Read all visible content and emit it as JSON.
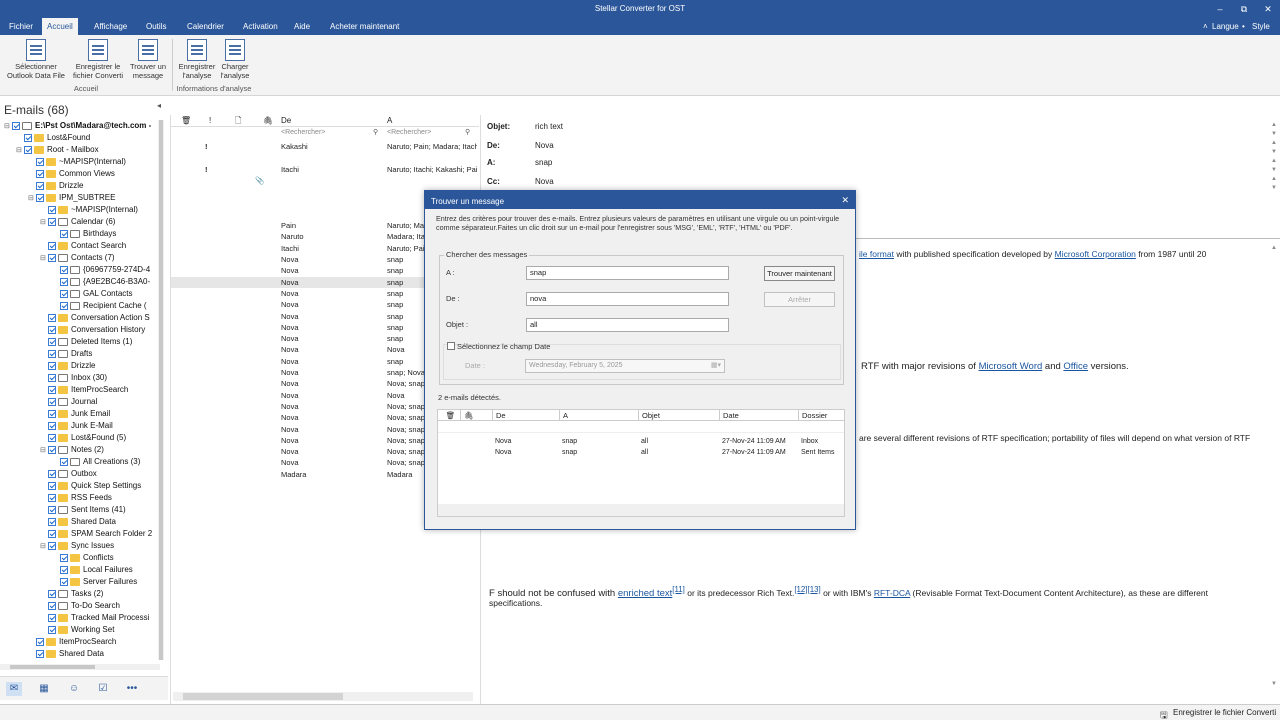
{
  "window": {
    "title": "Stellar Converter for OST",
    "min": "–",
    "max": "⧉",
    "close": "✕"
  },
  "menu": {
    "items": [
      "Fichier",
      "Accueil",
      "Affichage",
      "Outils",
      "Calendrier",
      "Activation",
      "Aide",
      "Acheter maintenant"
    ],
    "active": "Accueil",
    "langue": "Langue",
    "style": "Style"
  },
  "ribbon": {
    "buttons": [
      {
        "line1": "Sélectionner",
        "line2": "Outlook Data File"
      },
      {
        "line1": "Enregistrer le",
        "line2": "fichier Converti"
      },
      {
        "line1": "Trouver un",
        "line2": "message"
      },
      {
        "line1": "Enregistrer",
        "line2": "l'analyse"
      },
      {
        "line1": "Charger",
        "line2": "l'analyse"
      }
    ],
    "groups": [
      "Accueil",
      "Informations d'analyse"
    ]
  },
  "left": {
    "header": "E-mails (68)",
    "tree": [
      {
        "label": "E:\\Pst Ost\\Madara@tech.com -",
        "depth": 0,
        "exp": "⊟",
        "type": "root"
      },
      {
        "label": "Lost&Found",
        "depth": 1,
        "exp": "",
        "type": "folder"
      },
      {
        "label": "Root - Mailbox",
        "depth": 1,
        "exp": "⊟",
        "type": "folder"
      },
      {
        "label": "~MAPISP(Internal)",
        "depth": 2,
        "exp": "",
        "type": "folder"
      },
      {
        "label": "Common Views",
        "depth": 2,
        "exp": "",
        "type": "folder"
      },
      {
        "label": "Drizzle",
        "depth": 2,
        "exp": "",
        "type": "folder"
      },
      {
        "label": "IPM_SUBTREE",
        "depth": 2,
        "exp": "⊟",
        "type": "folder"
      },
      {
        "label": "~MAPISP(Internal)",
        "depth": 3,
        "exp": "",
        "type": "folder"
      },
      {
        "label": "Calendar (6)",
        "depth": 3,
        "exp": "⊟",
        "type": "special"
      },
      {
        "label": "Birthdays",
        "depth": 4,
        "exp": "",
        "type": "special"
      },
      {
        "label": "Contact Search",
        "depth": 3,
        "exp": "",
        "type": "folder"
      },
      {
        "label": "Contacts (7)",
        "depth": 3,
        "exp": "⊟",
        "type": "special"
      },
      {
        "label": "{06967759-274D-4",
        "depth": 4,
        "exp": "",
        "type": "special"
      },
      {
        "label": "{A9E2BC46-B3A0-",
        "depth": 4,
        "exp": "",
        "type": "special"
      },
      {
        "label": "GAL Contacts",
        "depth": 4,
        "exp": "",
        "type": "special"
      },
      {
        "label": "Recipient Cache (",
        "depth": 4,
        "exp": "",
        "type": "special"
      },
      {
        "label": "Conversation Action S",
        "depth": 3,
        "exp": "",
        "type": "folder"
      },
      {
        "label": "Conversation History",
        "depth": 3,
        "exp": "",
        "type": "folder"
      },
      {
        "label": "Deleted Items (1)",
        "depth": 3,
        "exp": "",
        "type": "special"
      },
      {
        "label": "Drafts",
        "depth": 3,
        "exp": "",
        "type": "special"
      },
      {
        "label": "Drizzle",
        "depth": 3,
        "exp": "",
        "type": "folder"
      },
      {
        "label": "Inbox (30)",
        "depth": 3,
        "exp": "",
        "type": "special"
      },
      {
        "label": "ItemProcSearch",
        "depth": 3,
        "exp": "",
        "type": "folder"
      },
      {
        "label": "Journal",
        "depth": 3,
        "exp": "",
        "type": "special"
      },
      {
        "label": "Junk Email",
        "depth": 3,
        "exp": "",
        "type": "folder"
      },
      {
        "label": "Junk E-Mail",
        "depth": 3,
        "exp": "",
        "type": "folder"
      },
      {
        "label": "Lost&Found (5)",
        "depth": 3,
        "exp": "",
        "type": "folder"
      },
      {
        "label": "Notes (2)",
        "depth": 3,
        "exp": "⊟",
        "type": "special"
      },
      {
        "label": "All Creations (3)",
        "depth": 4,
        "exp": "",
        "type": "special"
      },
      {
        "label": "Outbox",
        "depth": 3,
        "exp": "",
        "type": "special"
      },
      {
        "label": "Quick Step Settings",
        "depth": 3,
        "exp": "",
        "type": "folder"
      },
      {
        "label": "RSS Feeds",
        "depth": 3,
        "exp": "",
        "type": "folder"
      },
      {
        "label": "Sent Items (41)",
        "depth": 3,
        "exp": "",
        "type": "special"
      },
      {
        "label": "Shared Data",
        "depth": 3,
        "exp": "",
        "type": "folder"
      },
      {
        "label": "SPAM Search Folder 2",
        "depth": 3,
        "exp": "",
        "type": "folder"
      },
      {
        "label": "Sync Issues",
        "depth": 3,
        "exp": "⊟",
        "type": "folder"
      },
      {
        "label": "Conflicts",
        "depth": 4,
        "exp": "",
        "type": "folder"
      },
      {
        "label": "Local Failures",
        "depth": 4,
        "exp": "",
        "type": "folder"
      },
      {
        "label": "Server Failures",
        "depth": 4,
        "exp": "",
        "type": "folder"
      },
      {
        "label": "Tasks (2)",
        "depth": 3,
        "exp": "",
        "type": "special"
      },
      {
        "label": "To-Do Search",
        "depth": 3,
        "exp": "",
        "type": "special"
      },
      {
        "label": "Tracked Mail Processi",
        "depth": 3,
        "exp": "",
        "type": "folder"
      },
      {
        "label": "Working Set",
        "depth": 3,
        "exp": "",
        "type": "folder"
      },
      {
        "label": "ItemProcSearch",
        "depth": 2,
        "exp": "",
        "type": "folder"
      },
      {
        "label": "Shared Data",
        "depth": 2,
        "exp": "",
        "type": "folder"
      }
    ]
  },
  "list": {
    "columns": {
      "de": "De",
      "a": "A"
    },
    "search_placeholder": "<Rechercher>",
    "rows": [
      {
        "imp": "!",
        "att": "",
        "de": "Kakashi",
        "a": "Naruto; Pain; Madara; Itachi"
      },
      {
        "imp": "",
        "att": "",
        "de": "",
        "a": ""
      },
      {
        "imp": "!",
        "att": "",
        "de": "Itachi",
        "a": "Naruto; Itachi; Kakashi; Pain"
      },
      {
        "imp": "",
        "att": "📎",
        "de": "",
        "a": ""
      },
      {
        "imp": "",
        "att": "",
        "de": "",
        "a": ""
      },
      {
        "imp": "",
        "att": "",
        "de": "",
        "a": ""
      },
      {
        "imp": "",
        "att": "",
        "de": "",
        "a": ""
      },
      {
        "imp": "",
        "att": "",
        "de": "Pain",
        "a": "Naruto; Madara"
      },
      {
        "imp": "",
        "att": "",
        "de": "Naruto",
        "a": "Madara; Itachi"
      },
      {
        "imp": "",
        "att": "",
        "de": "Itachi",
        "a": "Naruto; Pain"
      },
      {
        "imp": "",
        "att": "",
        "de": "Nova",
        "a": "snap"
      },
      {
        "imp": "",
        "att": "",
        "de": "Nova",
        "a": "snap"
      },
      {
        "imp": "",
        "att": "",
        "de": "Nova",
        "a": "snap",
        "sel": true
      },
      {
        "imp": "",
        "att": "",
        "de": "Nova",
        "a": "snap"
      },
      {
        "imp": "",
        "att": "",
        "de": "Nova",
        "a": "snap"
      },
      {
        "imp": "",
        "att": "",
        "de": "Nova",
        "a": "snap"
      },
      {
        "imp": "",
        "att": "",
        "de": "Nova",
        "a": "snap"
      },
      {
        "imp": "",
        "att": "",
        "de": "Nova",
        "a": "snap"
      },
      {
        "imp": "",
        "att": "",
        "de": "Nova",
        "a": "Nova"
      },
      {
        "imp": "",
        "att": "",
        "de": "Nova",
        "a": "snap"
      },
      {
        "imp": "",
        "att": "",
        "de": "Nova",
        "a": "snap; Nova"
      },
      {
        "imp": "",
        "att": "",
        "de": "Nova",
        "a": "Nova; snap"
      },
      {
        "imp": "",
        "att": "",
        "de": "Nova",
        "a": "Nova"
      },
      {
        "imp": "",
        "att": "",
        "de": "Nova",
        "a": "Nova; snap"
      },
      {
        "imp": "",
        "att": "",
        "de": "Nova",
        "a": "Nova; snap"
      },
      {
        "imp": "",
        "att": "",
        "de": "Nova",
        "a": "Nova; snap"
      },
      {
        "imp": "",
        "att": "",
        "de": "Nova",
        "a": "Nova; snap"
      },
      {
        "imp": "",
        "att": "",
        "de": "Nova",
        "a": "Nova; snap"
      },
      {
        "imp": "",
        "att": "",
        "de": "Nova",
        "a": "Nova; snap"
      },
      {
        "imp": "",
        "att": "",
        "de": "Madara",
        "a": "Madara"
      }
    ]
  },
  "reading": {
    "labels": {
      "objet": "Objet:",
      "de": "De:",
      "a": "A:",
      "cc": "Cc:"
    },
    "objet": "rich text",
    "de": "Nova",
    "a": "snap",
    "cc": "Nova",
    "p1": {
      "link1": "ile format",
      "t1": " with published specification developed by ",
      "link2": "Microsoft Corporation",
      "t2": " from 1987 until 20"
    },
    "p2": {
      "t1": "RTF with major revisions of ",
      "link1": "Microsoft Word",
      "t2": " and ",
      "link2": "Office",
      "t3": " versions."
    },
    "p3": "are several different revisions of RTF specification; portability of files will depend on what version of RTF",
    "p4": {
      "t1": "F should not be confused with ",
      "link1": "enriched text",
      "sup1": "[11]",
      "t2": " or its predecessor Rich Text.",
      "sup2": "[12]",
      "sup3": "[13]",
      "t3": " or with IBM's ",
      "link2": "RFT-DCA",
      "t4": " (Revisable Format Text-Document Content Architecture), as these are different"
    },
    "p4b": "specifications."
  },
  "status": {
    "label": "Enregistrer le fichier Converti"
  },
  "dialog": {
    "title": "Trouver un message",
    "close": "✕",
    "intro1": "Entrez des critères pour trouver des e-mails. Entrez plusieurs valeurs de paramètres en utilisant une virgule ou un point-virgule",
    "intro2": "comme séparateur.Faites un clic droit sur un e-mail pour l'enregistrer sous 'MSG', 'EML', 'RTF', 'HTML' ou 'PDF'.",
    "group": "Chercher des messages",
    "labels": {
      "a": "A :",
      "de": "De :",
      "objet": "Objet :"
    },
    "values": {
      "a": "snap",
      "de": "nova",
      "objet": "all"
    },
    "find_btn": "Trouver maintenant",
    "stop_btn": "Arrêter",
    "date_chk": "Sélectionnez le champ Date",
    "date_label": "Date :",
    "date_value": "Wednesday,  February    5, 2025",
    "count": "2 e-mails détectés.",
    "result_cols": {
      "de": "De",
      "a": "A",
      "objet": "Objet",
      "date": "Date",
      "dossier": "Dossier"
    },
    "results": [
      {
        "de": "Nova",
        "a": "snap",
        "objet": "all",
        "date": "27-Nov-24 11:09 AM",
        "dossier": "Inbox"
      },
      {
        "de": "Nova",
        "a": "snap",
        "objet": "all",
        "date": "27-Nov-24 11:09 AM",
        "dossier": "Sent Items"
      }
    ]
  },
  "colors": {
    "accent": "#2b579a",
    "link": "#1a56a0",
    "ribbon_bg": "#f3f3f3"
  }
}
